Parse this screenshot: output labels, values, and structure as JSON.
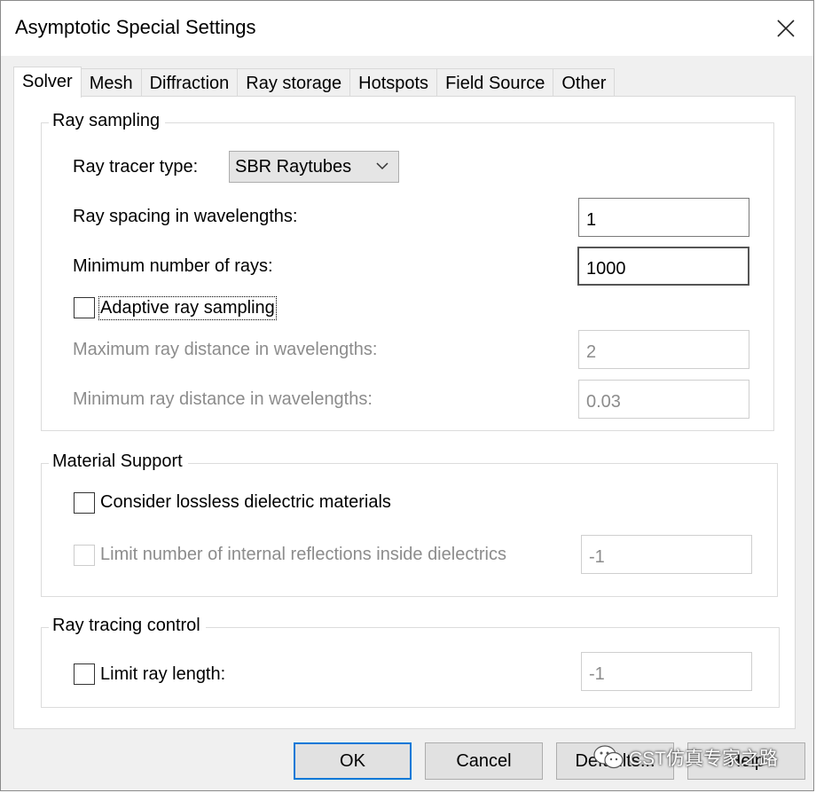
{
  "window": {
    "title": "Asymptotic Special Settings"
  },
  "tabs": [
    {
      "label": "Solver",
      "active": true
    },
    {
      "label": "Mesh"
    },
    {
      "label": "Diffraction"
    },
    {
      "label": "Ray storage"
    },
    {
      "label": "Hotspots"
    },
    {
      "label": "Field Source"
    },
    {
      "label": "Other"
    }
  ],
  "ray_sampling": {
    "group_label": "Ray sampling",
    "tracer_type_label": "Ray tracer type:",
    "tracer_type_value": "SBR Raytubes",
    "spacing_label": "Ray spacing in wavelengths:",
    "spacing_value": "1",
    "min_rays_label": "Minimum number of rays:",
    "min_rays_value": "1000",
    "adaptive_label": "Adaptive ray sampling",
    "max_dist_label": "Maximum ray distance in wavelengths:",
    "max_dist_value": "2",
    "min_dist_label": "Minimum ray distance in wavelengths:",
    "min_dist_value": "0.03"
  },
  "material_support": {
    "group_label": "Material Support",
    "lossless_label": "Consider lossless dielectric materials",
    "limit_reflections_label": "Limit number of internal reflections inside dielectrics",
    "limit_reflections_value": "-1"
  },
  "ray_tracing_control": {
    "group_label": "Ray tracing control",
    "limit_length_label": "Limit ray length:",
    "limit_length_value": "-1"
  },
  "buttons": {
    "ok": "OK",
    "cancel": "Cancel",
    "defaults": "Defaults...",
    "help": "Help"
  },
  "watermark": {
    "text": "CST仿真专家之路"
  },
  "colors": {
    "accent": "#0078d7",
    "disabled_text": "#8c8c8c"
  }
}
